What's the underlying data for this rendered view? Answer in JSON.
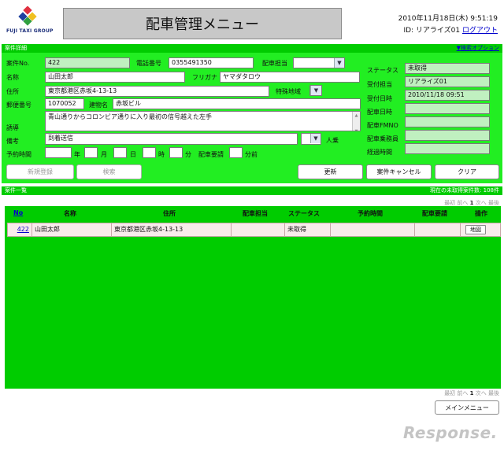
{
  "header": {
    "logo_text": "FUJI TAXI GROUP",
    "title": "配車管理メニュー",
    "datetime": "2010年11月18日(木) 9:51:19",
    "user_id": "ID: リアライズ01",
    "logout": "ログアウト"
  },
  "detail": {
    "bar_title": "案件詳細",
    "search_option": "▼検索オプション",
    "labels": {
      "case_no": "案件No.",
      "phone": "電話番号",
      "dispatcher": "配車担当",
      "name": "名称",
      "furigana": "フリガナ",
      "address": "住所",
      "special_area": "特殊地域",
      "postal": "郵便番号",
      "building": "建物名",
      "guide": "誘導",
      "note": "備考",
      "passengers": "人乗",
      "reserve_time": "予約時間",
      "year": "年",
      "month": "月",
      "day": "日",
      "hour": "時",
      "minute": "分",
      "dispatch_request": "配車要請",
      "minutes_before": "分前"
    },
    "values": {
      "case_no": "422",
      "phone": "0355491350",
      "name": "山田太郎",
      "furigana": "ヤマダタロウ",
      "address": "東京都港区赤坂4-13-13",
      "postal": "1070052",
      "building": "赤坂ビル",
      "guide": "青山通りからコロンビア通りに入り最初の信号越えた左手",
      "note": "到着送信"
    },
    "status_labels": [
      "ステータス",
      "受付担当",
      "受付日時",
      "配車日時",
      "配車FMNO",
      "配車乗務員",
      "経過時間"
    ],
    "status_values": [
      "未取得",
      "リアライズ01",
      "2010/11/18 09:51",
      "",
      "",
      "",
      ""
    ],
    "buttons": {
      "new_register": "新規登録",
      "search": "検索",
      "update": "更新",
      "cancel_case": "案件キャンセル",
      "clear": "クリア"
    }
  },
  "list": {
    "bar_title": "案件一覧",
    "pending_count": "現在の未取得案件数: 108件",
    "pager_top": {
      "first": "最初",
      "prev": "前へ",
      "page": "1",
      "next": "次へ",
      "last": "最後"
    },
    "pager_bottom": {
      "first": "最初",
      "prev": "前へ",
      "page": "1",
      "next": "次へ",
      "last": "最後"
    },
    "columns": [
      "No",
      "名称",
      "住所",
      "配車担当",
      "ステータス",
      "予約時間",
      "配車要請",
      "操作"
    ],
    "rows": [
      {
        "no": "422",
        "name": "山田太郎",
        "address": "東京都港区赤坂4-13-13",
        "dispatcher": "",
        "status": "未取得",
        "reserve_time": "",
        "dispatch_request": "",
        "action": "地図"
      }
    ]
  },
  "footer": {
    "main_menu": "メインメニュー",
    "watermark": "Response."
  },
  "colors": {
    "panel_green": "#22ee22",
    "bar_green": "#00cc00",
    "list_green": "#00cc00",
    "readonly_field": "#c0f0c0",
    "link_blue": "#0000cc",
    "row_pink": "#f8ecec"
  }
}
